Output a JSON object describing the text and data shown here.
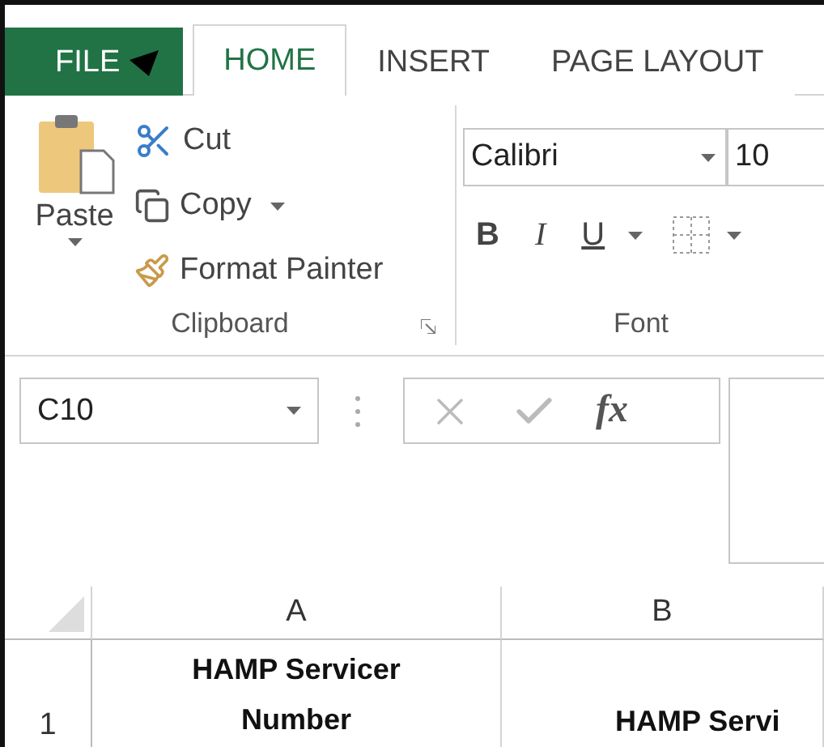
{
  "tabs": [
    {
      "label": "FILE",
      "kind": "file",
      "selected": false
    },
    {
      "label": "HOME",
      "kind": "tab",
      "selected": true
    },
    {
      "label": "INSERT",
      "kind": "tab",
      "selected": false
    },
    {
      "label": "PAGE LAYOUT",
      "kind": "tab",
      "selected": false
    }
  ],
  "clipboard": {
    "paste": "Paste",
    "actions": [
      {
        "label": "Cut",
        "kind": "cut",
        "dropdown": false
      },
      {
        "label": "Copy",
        "kind": "copy",
        "dropdown": true
      },
      {
        "label": "Format Painter",
        "kind": "painter",
        "dropdown": false
      }
    ],
    "label": "Clipboard"
  },
  "font": {
    "name": "Calibri",
    "size": "10",
    "styles": [
      {
        "label": "B",
        "kind": "bold"
      },
      {
        "label": "I",
        "kind": "italic"
      },
      {
        "label": "U",
        "kind": "underline"
      }
    ],
    "label": "Font"
  },
  "formula_bar": {
    "name_box": "C10",
    "function_label": "fx"
  },
  "sheet": {
    "columns": [
      "A",
      "B"
    ],
    "rows": [
      {
        "header": "1",
        "cells": [
          "HAMP Servicer Number",
          "HAMP Servi"
        ]
      }
    ]
  }
}
